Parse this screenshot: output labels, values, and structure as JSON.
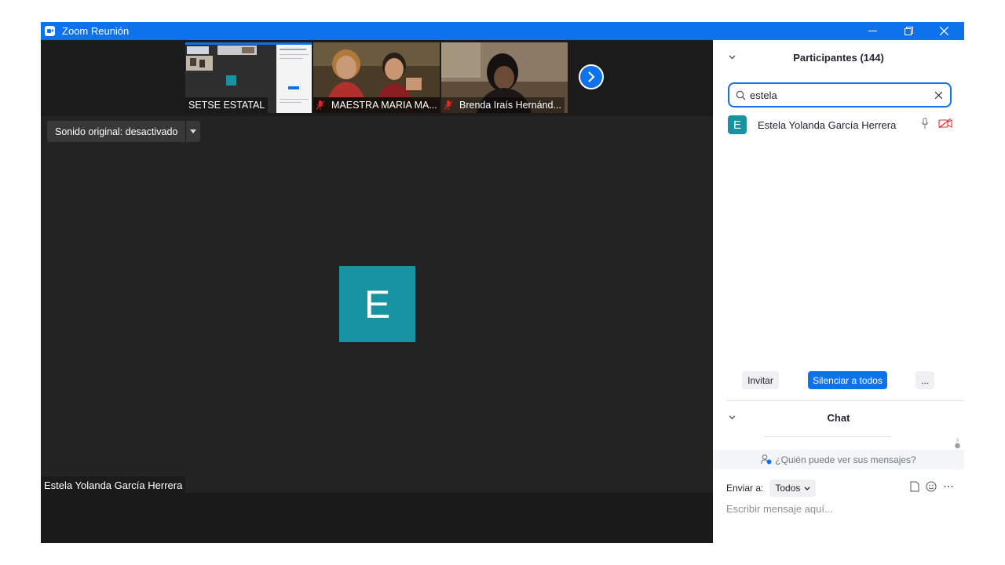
{
  "window": {
    "title": "Zoom Reunión"
  },
  "thumbnails": [
    {
      "name": "SETSE ESTATAL",
      "muted": false
    },
    {
      "name": "MAESTRA MARIA MA...",
      "muted": true
    },
    {
      "name": "Brenda Iraís Hernánd...",
      "muted": true
    }
  ],
  "video": {
    "sound_label": "Sonido original: desactivado",
    "avatar_letter": "E",
    "active_speaker": "Estela Yolanda García Herrera"
  },
  "participants": {
    "header": "Participantes (144)",
    "search_value": "estela",
    "list": [
      {
        "initial": "E",
        "name": "Estela Yolanda García Herrera"
      }
    ],
    "invite_label": "Invitar",
    "mute_all_label": "Silenciar a todos",
    "more_label": "..."
  },
  "chat": {
    "header": "Chat",
    "who_can_see": "¿Quién puede ver sus mensajes?",
    "send_to_label": "Enviar a:",
    "send_to_value": "Todos",
    "input_placeholder": "Escribir mensaje aquí..."
  },
  "colors": {
    "accent": "#0e72ed",
    "avatar": "#1893a1",
    "muted": "#e02828"
  }
}
